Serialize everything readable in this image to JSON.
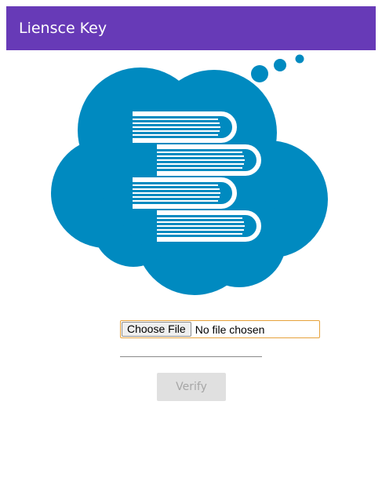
{
  "app": {
    "title": "Liensce Key",
    "accent_color": "#673ab7"
  },
  "logo": {
    "icon": "books-cloud-icon",
    "color": "#008ac0"
  },
  "file_upload": {
    "button_label": "Choose File",
    "status_text": "No file chosen"
  },
  "license_input": {
    "value": "",
    "placeholder": ""
  },
  "verify": {
    "label": "Verify",
    "disabled": true
  }
}
